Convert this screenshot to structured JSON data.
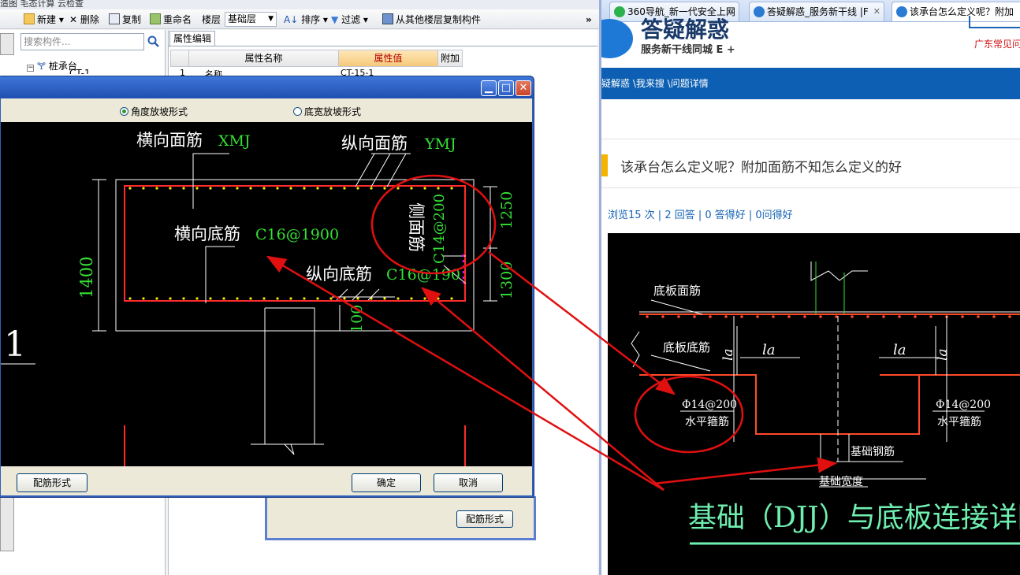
{
  "left_app": {
    "top_strip_partial": "造图   毛态计算   云检查",
    "toolbar": {
      "new": "新建",
      "delete": "删除",
      "copy": "复制",
      "rename": "重命名",
      "floor_label": "楼层",
      "floor_value": "基础层",
      "sort": "排序",
      "filter": "过滤",
      "copy_from_floor": "从其他楼层复制构件",
      "more": "»"
    },
    "search_placeholder": "搜索构件...",
    "tree": {
      "root": "桩承台",
      "child_partial": "CT-1"
    },
    "property_tab": "属性编辑",
    "grid_headers": {
      "name": "属性名称",
      "value": "属性值",
      "extra": "附加"
    },
    "grid_row1": {
      "num": "1",
      "name": "名称",
      "value": "CT-15-1"
    },
    "sub_dialog_button": "配筋形式"
  },
  "dialog": {
    "radio_angle": "角度放坡形式",
    "radio_width": "底宽放坡形式",
    "btn_reinforce": "配筋形式",
    "btn_ok": "确定",
    "btn_cancel": "取消",
    "drawing": {
      "top_transverse_label": "横向面筋",
      "top_transverse_code": "XMJ",
      "top_longitudinal_label": "纵向面筋",
      "top_longitudinal_code": "YMJ",
      "bottom_transverse_label": "横向底筋",
      "bottom_transverse_code": "C16@1900",
      "bottom_longitudinal_label": "纵向底筋",
      "bottom_longitudinal_code": "C16@190",
      "side_label": "侧面筋",
      "side_code": "C14@200",
      "dim_height": "1400",
      "dim_right_top": "1250",
      "dim_right_bottom": "1300",
      "dim_bottom": "100",
      "left_marker": "1"
    }
  },
  "browser": {
    "tabs": [
      "360导航_新一代安全上网",
      "答疑解惑_服务新干线 |F",
      "该承台怎么定义呢？附加"
    ],
    "site_title_partial": "答疑解惑",
    "site_subtitle": "服务新干线同城 E +",
    "region_link": "广东常见问",
    "breadcrumb": "疑解惑 \\我来搜 \\问题详情",
    "question_title": "该承台怎么定义呢？附加面筋不知怎么定义的好",
    "stats": "浏览15 次 | 2 回答 | 0 答得好 | 0问得好",
    "detail": {
      "slab_top": "底板面筋",
      "slab_bottom": "底板底筋",
      "la": "la",
      "stirrup_code": "Φ14@200",
      "stirrup_label": "水平箍筋",
      "foundation_bar": "基础钢筋",
      "foundation_width": "基础宽度",
      "caption": "基础（DJJ）与底板连接详图"
    }
  },
  "colors": {
    "rebar_red": "#ff2a2a",
    "cad_green": "#35e035",
    "annotation_red": "#e01010",
    "caption_green": "#6ff0b0"
  }
}
